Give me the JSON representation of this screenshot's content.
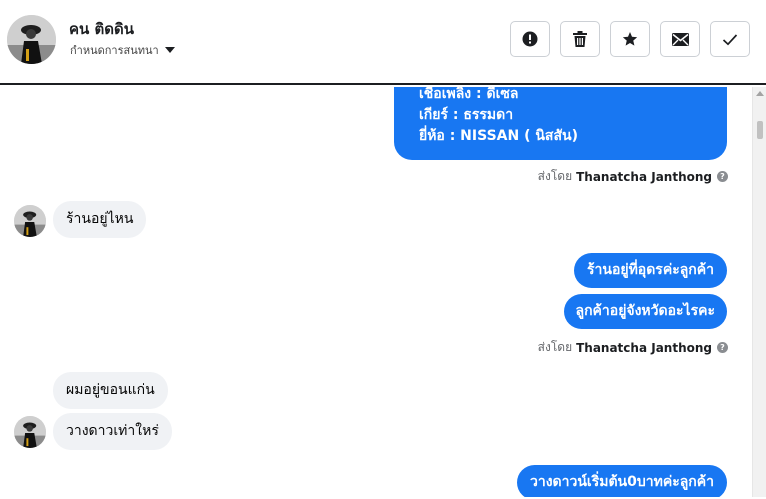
{
  "header": {
    "contact_name": "คน ติดดิน",
    "conversation_menu_label": "กำหนดการสนทนา",
    "actions": [
      {
        "name": "mark-spam-button",
        "icon": "alert-circle-icon"
      },
      {
        "name": "delete-button",
        "icon": "trash-icon"
      },
      {
        "name": "star-button",
        "icon": "star-icon"
      },
      {
        "name": "mark-unread-button",
        "icon": "envelope-icon"
      },
      {
        "name": "mark-done-button",
        "icon": "checkmark-icon"
      }
    ]
  },
  "messages": {
    "car_details": {
      "fuel": "เชื้อเพลิง : ดีเซล",
      "gear": "เกียร์ : ธรรมดา",
      "brand": "ยี่ห้อ : NISSAN ( นิสสัน)"
    },
    "sent_by_prefix": "ส่งโดย",
    "sent_by_name": "Thanatcha Janthong",
    "help_glyph": "?",
    "m1_in": "ร้านอยู่ไหน",
    "m2_out": "ร้านอยู่ที่อุดรค่ะลูกค้า",
    "m3_out": "ลูกค้าอยู่จังหวัดอะไรคะ",
    "m4_in": "ผมอยู่ขอนแก่น",
    "m5_in": "วางดาวเท่าใหร่",
    "m6_out": "วางดาวน์เริ่มต้น0บาทค่ะลูกค้า"
  },
  "colors": {
    "outgoing_bubble": "#1877f2",
    "incoming_bubble": "#f0f2f5",
    "meta_text": "#65676b"
  }
}
